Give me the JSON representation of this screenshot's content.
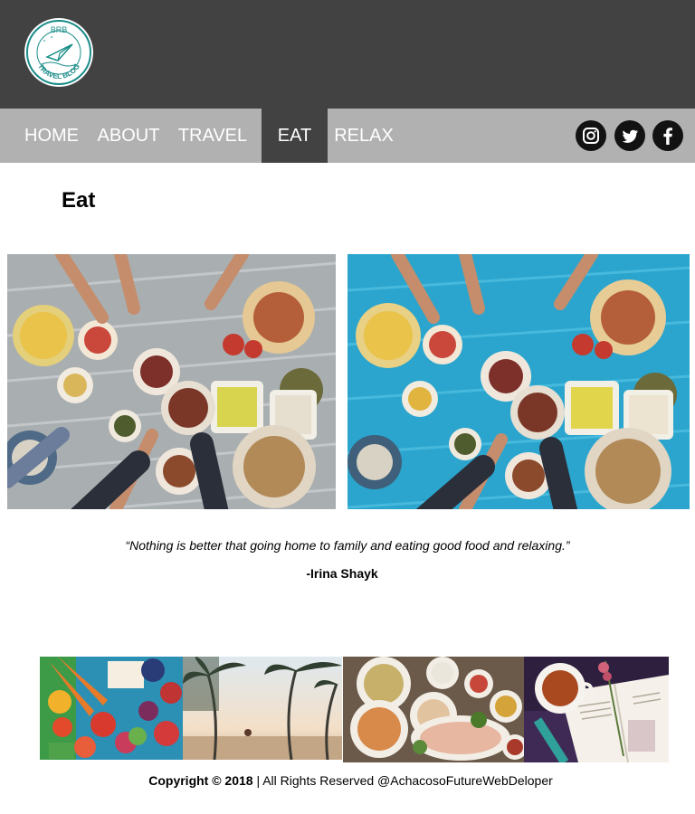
{
  "logo": {
    "top_text": "BRB",
    "ring_text": "TRAVEL BLOG"
  },
  "nav": {
    "items": [
      {
        "label": "HOME",
        "active": false
      },
      {
        "label": "ABOUT",
        "active": false
      },
      {
        "label": "TRAVEL",
        "active": false
      },
      {
        "label": "EAT",
        "active": true
      },
      {
        "label": "RELAX",
        "active": false
      }
    ]
  },
  "social": {
    "icons": [
      "instagram-icon",
      "twitter-icon",
      "facebook-icon"
    ]
  },
  "page": {
    "title": "Eat"
  },
  "photos": {
    "hero": [
      "food-table-photo-grey",
      "food-table-photo-blue"
    ],
    "gallery": [
      "vegetables-photo",
      "palm-beach-photo",
      "soup-dishes-photo",
      "tea-book-photo"
    ]
  },
  "quote": {
    "text": "“Nothing is better that going home to family and eating good food and relaxing.”",
    "author": "-Irina Shayk"
  },
  "footer": {
    "copyright": "Copyright © 2018",
    "rights": " | All Rights Reserved @AchacosoFutureWebDeloper"
  },
  "colors": {
    "header_bg": "#424242",
    "nav_bg": "#b1b1b1",
    "active_bg": "#424242",
    "logo_teal": "#1b8d89"
  }
}
